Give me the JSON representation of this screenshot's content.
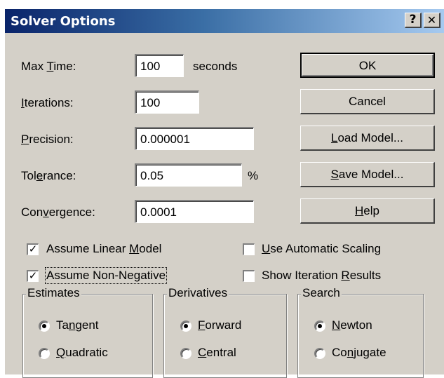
{
  "window": {
    "title": "Solver Options",
    "help_glyph": "?",
    "close_glyph": "✕"
  },
  "fields": {
    "max_time": {
      "label_pre": "Max ",
      "label_key": "T",
      "label_post": "ime:",
      "value": "100",
      "unit": "seconds"
    },
    "iterations": {
      "label_pre": "",
      "label_key": "I",
      "label_post": "terations:",
      "value": "100"
    },
    "precision": {
      "label_pre": "",
      "label_key": "P",
      "label_post": "recision:",
      "value": "0.000001"
    },
    "tolerance": {
      "label_pre": "Tol",
      "label_key": "e",
      "label_post": "rance:",
      "value": "0.05",
      "unit": "%"
    },
    "convergence": {
      "label_pre": "Con",
      "label_key": "v",
      "label_post": "ergence:",
      "value": "0.0001"
    }
  },
  "buttons": {
    "ok": {
      "pre": "OK",
      "key": "",
      "post": ""
    },
    "cancel": {
      "pre": "Cancel",
      "key": "",
      "post": ""
    },
    "load_model": {
      "pre": "",
      "key": "L",
      "post": "oad Model..."
    },
    "save_model": {
      "pre": "",
      "key": "S",
      "post": "ave Model..."
    },
    "help": {
      "pre": "",
      "key": "H",
      "post": "elp"
    }
  },
  "checkboxes": {
    "linear": {
      "pre": "Assume Linear ",
      "key": "M",
      "post": "odel",
      "checked": true
    },
    "nonneg": {
      "pre": "Assume Non-Ne",
      "key": "g",
      "post": "ative",
      "checked": true
    },
    "auto_scaling": {
      "pre": "",
      "key": "U",
      "post": "se Automatic Scaling",
      "checked": false
    },
    "iter_results": {
      "pre": "Show Iteration ",
      "key": "R",
      "post": "esults",
      "checked": false
    }
  },
  "check_glyph": "✓",
  "groups": {
    "estimates": {
      "title": "Estimates",
      "opt1": {
        "pre": "Ta",
        "key": "n",
        "post": "gent",
        "selected": true
      },
      "opt2": {
        "pre": "",
        "key": "Q",
        "post": "uadratic",
        "selected": false
      }
    },
    "derivatives": {
      "title": "Derivatives",
      "opt1": {
        "pre": "",
        "key": "F",
        "post": "orward",
        "selected": true
      },
      "opt2": {
        "pre": "",
        "key": "C",
        "post": "entral",
        "selected": false
      }
    },
    "search": {
      "title": "Search",
      "opt1": {
        "pre": "",
        "key": "N",
        "post": "ewton",
        "selected": true
      },
      "opt2": {
        "pre": "Co",
        "key": "n",
        "post": "jugate",
        "selected": false
      }
    }
  }
}
